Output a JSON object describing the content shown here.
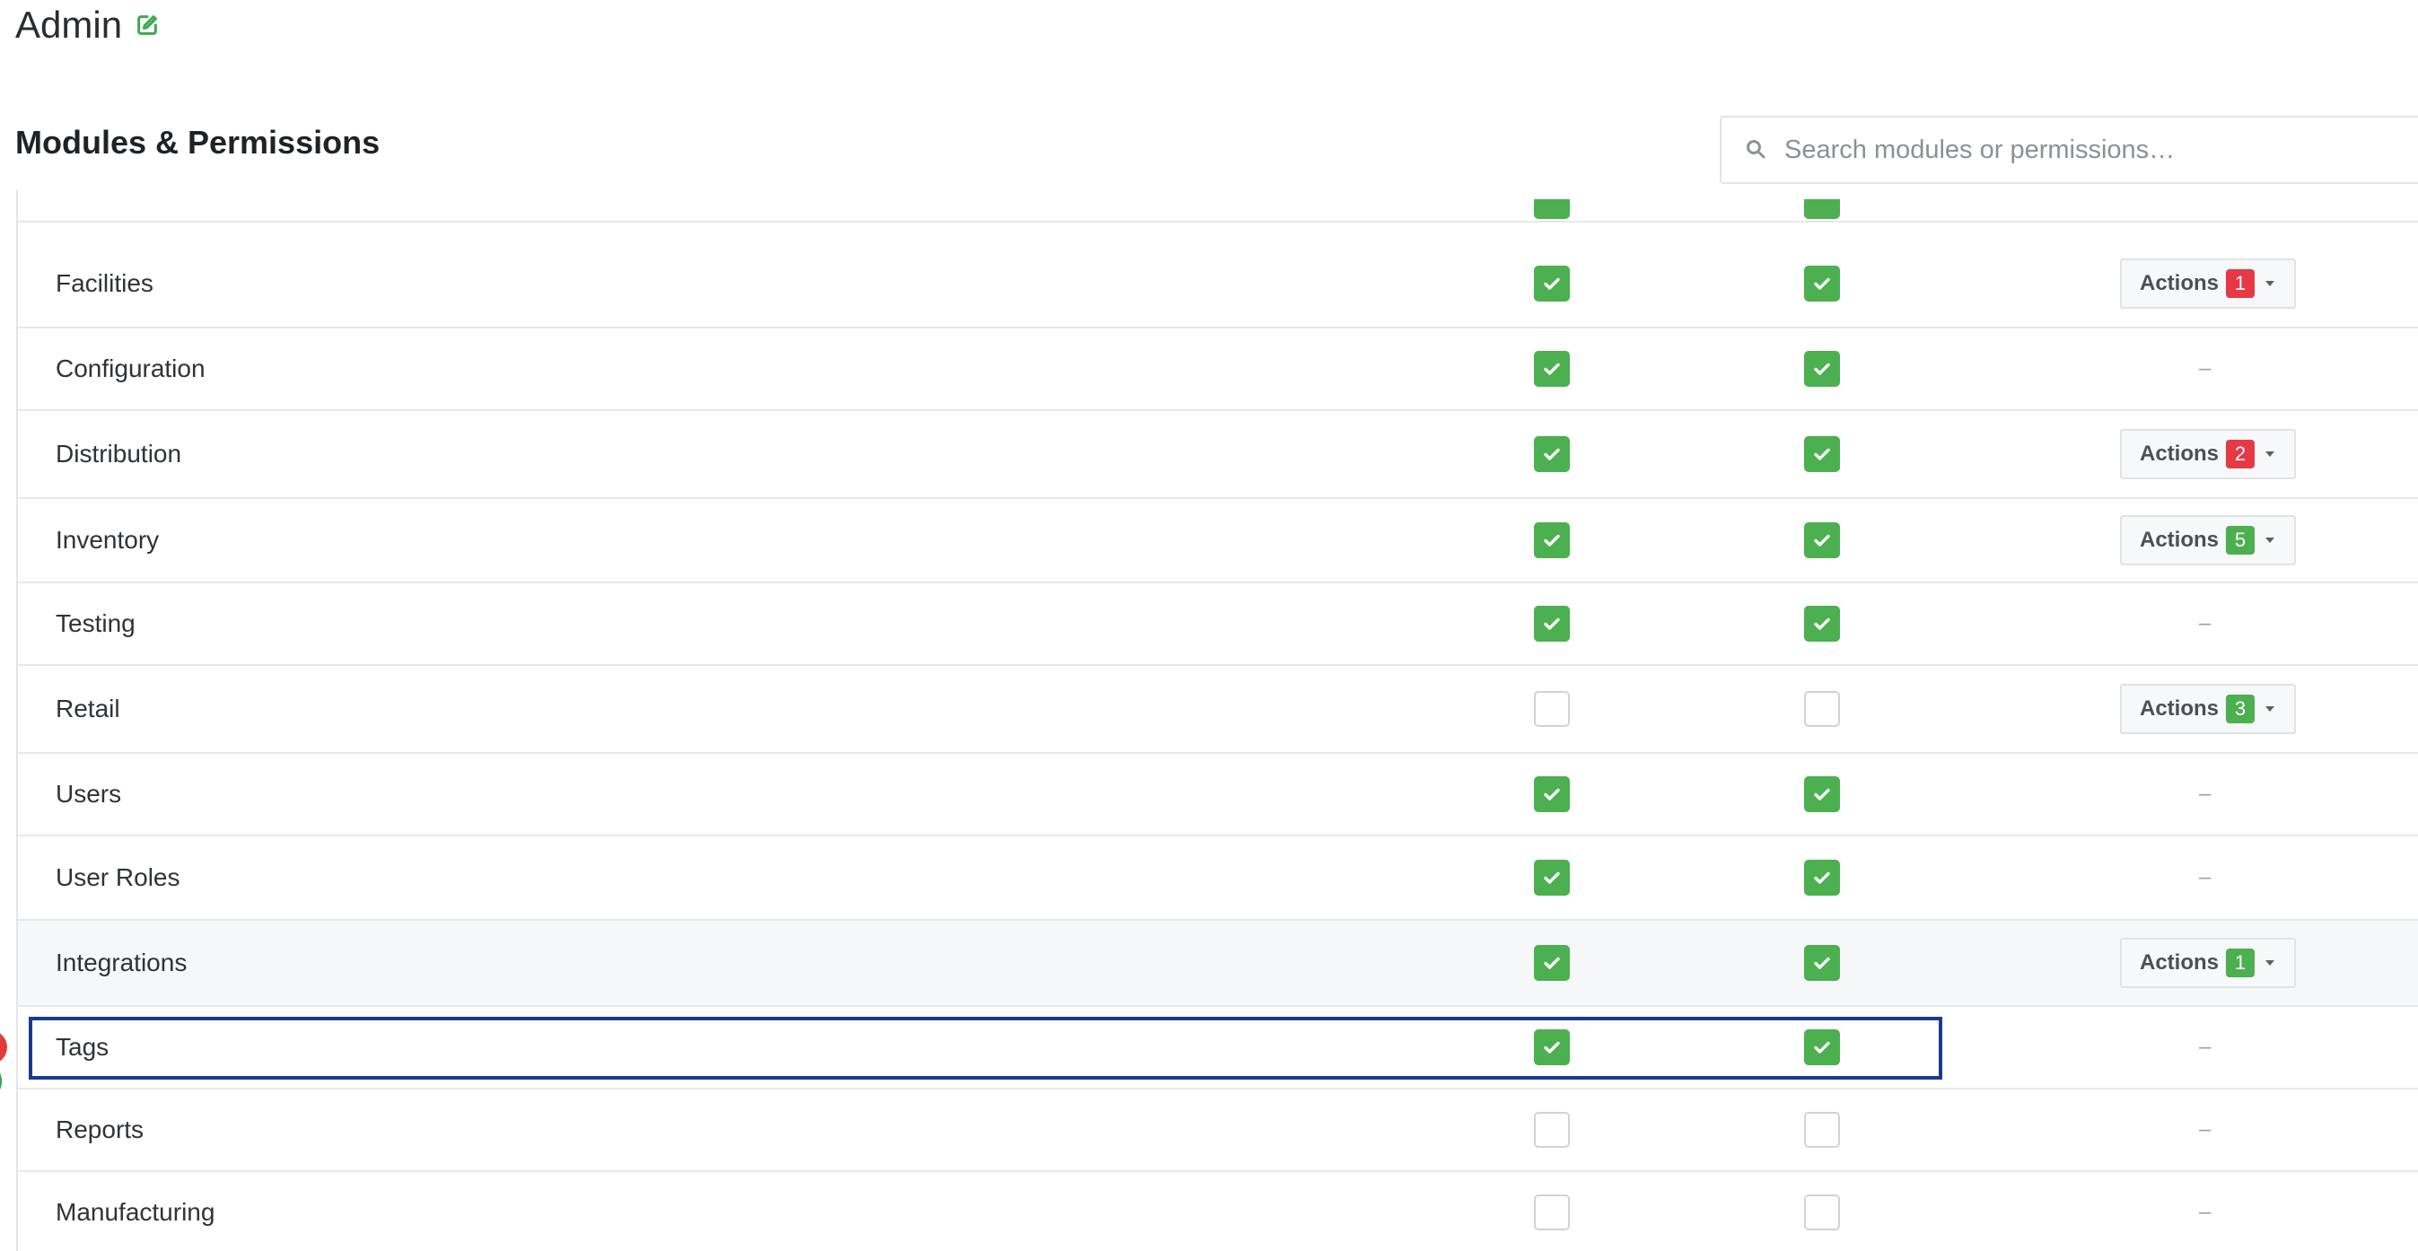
{
  "header": {
    "title": "Admin"
  },
  "section": {
    "title": "Modules & Permissions",
    "search_placeholder": "Search modules or permissions…"
  },
  "colors": {
    "checked": "#4caf50",
    "badge_red": "#e53945",
    "badge_green": "#4caf50",
    "selection": "#1b3a8f"
  },
  "rows": [
    {
      "label": "Facilities",
      "read": true,
      "write": true,
      "actions": {
        "label": "Actions",
        "count": "1",
        "color": "red"
      }
    },
    {
      "label": "Configuration",
      "read": true,
      "write": true,
      "dash": "–"
    },
    {
      "label": "Distribution",
      "read": true,
      "write": true,
      "actions": {
        "label": "Actions",
        "count": "2",
        "color": "red"
      }
    },
    {
      "label": "Inventory",
      "read": true,
      "write": true,
      "actions": {
        "label": "Actions",
        "count": "5",
        "color": "green"
      }
    },
    {
      "label": "Testing",
      "read": true,
      "write": true,
      "dash": "–"
    },
    {
      "label": "Retail",
      "read": false,
      "write": false,
      "actions": {
        "label": "Actions",
        "count": "3",
        "color": "green"
      }
    },
    {
      "label": "Users",
      "read": true,
      "write": true,
      "dash": "–"
    },
    {
      "label": "User Roles",
      "read": true,
      "write": true,
      "dash": "–"
    },
    {
      "label": "Integrations",
      "read": true,
      "write": true,
      "actions": {
        "label": "Actions",
        "count": "1",
        "color": "green"
      }
    },
    {
      "label": "Tags",
      "read": true,
      "write": true,
      "dash": "–"
    },
    {
      "label": "Reports",
      "read": false,
      "write": false,
      "dash": "–"
    },
    {
      "label": "Manufacturing",
      "read": false,
      "write": false,
      "dash": "–"
    }
  ]
}
